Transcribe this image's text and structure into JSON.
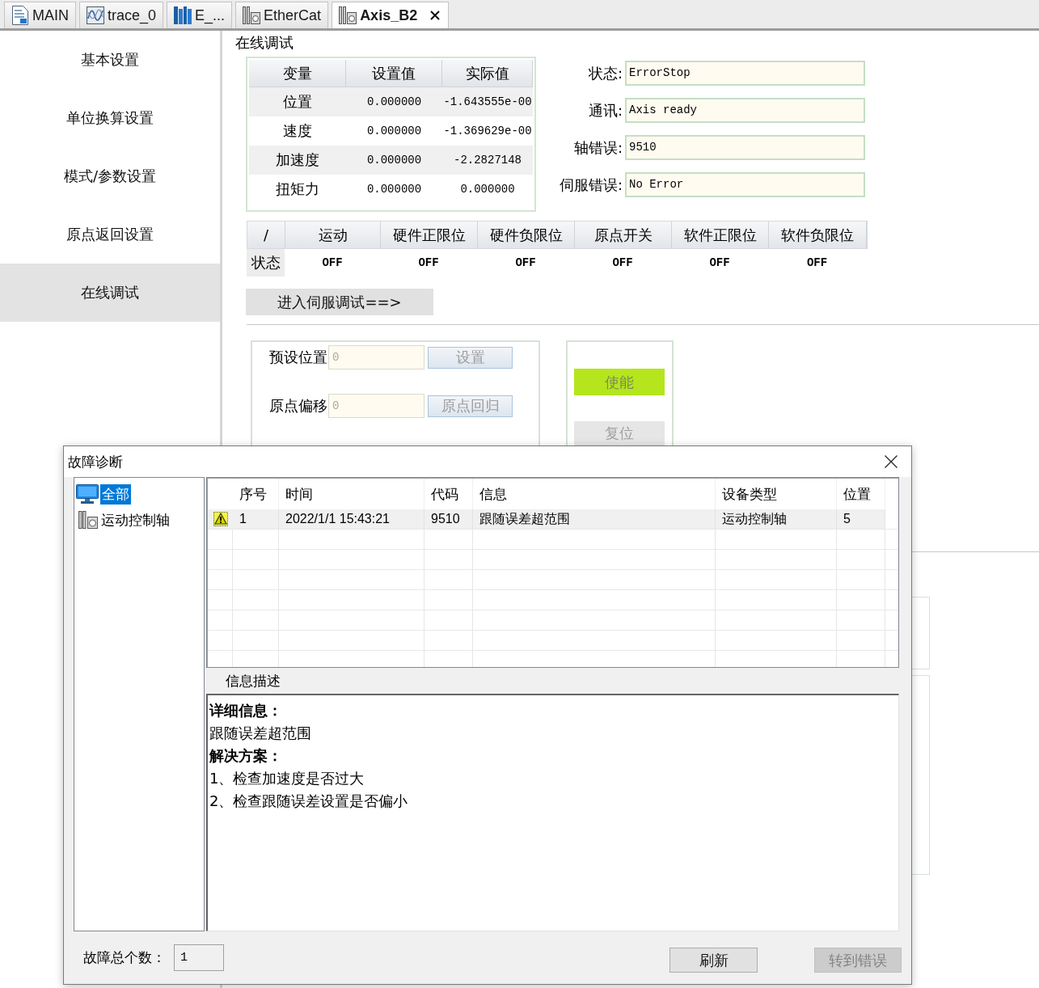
{
  "tabs": [
    {
      "label": "MAIN",
      "kind": "program",
      "selected": false
    },
    {
      "label": "trace_0",
      "kind": "trace",
      "selected": false
    },
    {
      "label": "E_...",
      "kind": "rack",
      "selected": false
    },
    {
      "label": "EtherCat",
      "kind": "axis",
      "selected": false
    },
    {
      "label": "Axis_B2",
      "kind": "axis",
      "selected": true
    }
  ],
  "sidebar": {
    "items": [
      {
        "label": "基本设置",
        "selected": false
      },
      {
        "label": "单位换算设置",
        "selected": false
      },
      {
        "label": "模式/参数设置",
        "selected": false
      },
      {
        "label": "原点返回设置",
        "selected": false
      },
      {
        "label": "在线调试",
        "selected": true
      }
    ]
  },
  "online_debug": {
    "title": "在线调试",
    "variables": {
      "columns": [
        "变量",
        "设置值",
        "实际值"
      ],
      "rows": [
        [
          "位置",
          "0.000000",
          "-1.643555e-00"
        ],
        [
          "速度",
          "0.000000",
          "-1.369629e-00"
        ],
        [
          "加速度",
          "0.000000",
          "-2.2827148"
        ],
        [
          "扭矩力",
          "0.000000",
          "0.000000"
        ]
      ]
    },
    "status_fields": [
      {
        "label": "状态:",
        "value": "ErrorStop"
      },
      {
        "label": "通讯:",
        "value": "Axis ready"
      },
      {
        "label": "轴错误:",
        "value": "9510"
      },
      {
        "label": "伺服错误:",
        "value": "No Error"
      }
    ],
    "signals": {
      "columns": [
        "/",
        "运动",
        "硬件正限位",
        "硬件负限位",
        "原点开关",
        "软件正限位",
        "软件负限位"
      ],
      "row": [
        "状态",
        "OFF",
        "OFF",
        "OFF",
        "OFF",
        "OFF",
        "OFF"
      ]
    },
    "servo_button": "进入伺服调试==>",
    "preset_rows": [
      {
        "label": "预设位置",
        "value": "0",
        "button": "设置",
        "disabled": true
      },
      {
        "label": "原点偏移",
        "value": "0",
        "button": "原点回归",
        "disabled": true
      }
    ],
    "enable_button": {
      "label": "使能",
      "disabled": true
    },
    "reset_button": {
      "label": "复位",
      "disabled": true
    }
  },
  "dialog": {
    "title": "故障诊断",
    "tree": [
      {
        "label": "全部",
        "kind": "all",
        "selected": true
      },
      {
        "label": "运动控制轴",
        "kind": "axis",
        "selected": false
      }
    ],
    "faults": {
      "columns": [
        "序号",
        "时间",
        "代码",
        "信息",
        "设备类型",
        "位置"
      ],
      "rows": [
        {
          "kind": "warning",
          "selected": true,
          "cells": [
            "1",
            "2022/1/1 15:43:21",
            "9510",
            "跟随误差超范围",
            "运动控制轴",
            "5"
          ]
        }
      ]
    },
    "description": {
      "label": "信息描述",
      "lines": [
        {
          "kind": "heading",
          "text": "详细信息："
        },
        {
          "kind": "text",
          "text": "跟随误差超范围"
        },
        {
          "kind": "heading",
          "text": "解决方案："
        },
        {
          "kind": "text",
          "text": "1、检查加速度是否过大"
        },
        {
          "kind": "text",
          "text": "2、检查跟随误差设置是否偏小"
        }
      ]
    },
    "count_label": "故障总个数：",
    "count_value": "1",
    "buttons": [
      {
        "label": "刷新",
        "disabled": false
      },
      {
        "label": "转到错误",
        "disabled": true
      }
    ]
  }
}
